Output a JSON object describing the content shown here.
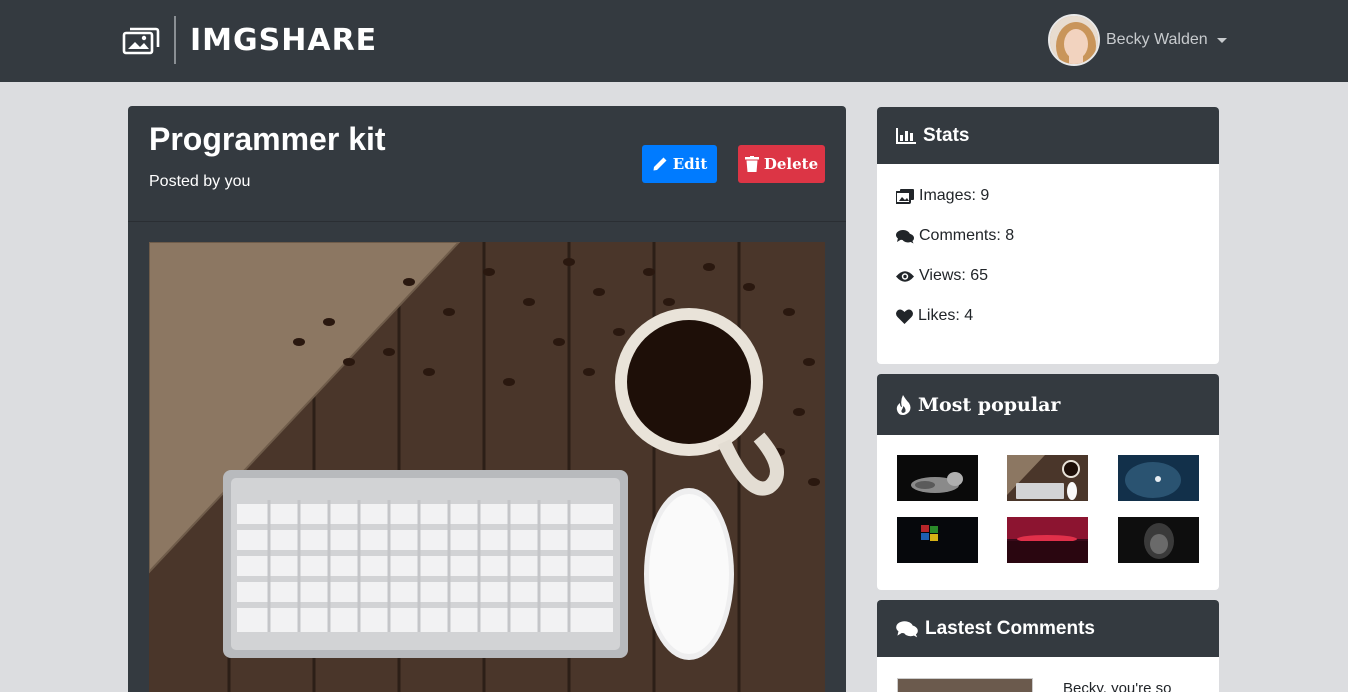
{
  "nav": {
    "brand": "IMGSHARE",
    "user_name": "Becky Walden"
  },
  "post": {
    "title": "Programmer kit",
    "subtitle": "Posted by you",
    "edit_label": "Edit",
    "delete_label": "Delete"
  },
  "stats": {
    "title": "Stats",
    "items": [
      {
        "icon": "images-icon",
        "label": "Images: 9"
      },
      {
        "icon": "comments-icon",
        "label": "Comments: 8"
      },
      {
        "icon": "eye-icon",
        "label": "Views: 65"
      },
      {
        "icon": "heart-icon",
        "label": "Likes: 4"
      }
    ]
  },
  "popular": {
    "title": "Most popular"
  },
  "comments": {
    "title": "Lastest Comments",
    "items": [
      {
        "text": "Becky, you're so"
      }
    ]
  },
  "colors": {
    "navbar": "#343a40",
    "edit": "#007bff",
    "delete": "#dc3545",
    "page_bg": "#dcdde0"
  }
}
